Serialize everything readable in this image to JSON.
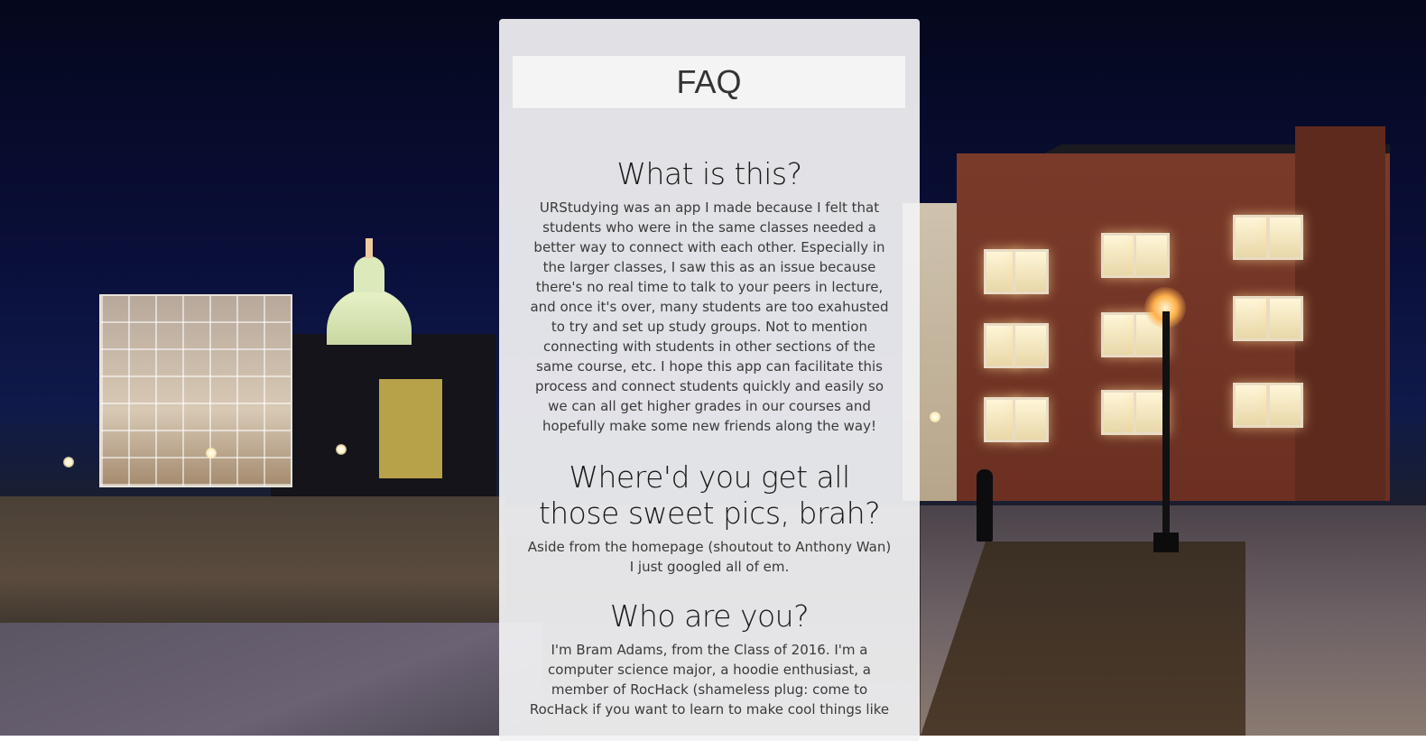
{
  "header": {
    "title": "FAQ"
  },
  "faq": [
    {
      "question": "What is this?",
      "answer": "URStudying was an app I made because I felt that students who were in the same classes needed a better way to connect with each other. Especially in the larger classes, I saw this as an issue because there's no real time to talk to your peers in lecture, and once it's over, many students are too exahusted to try and set up study groups. Not to mention connecting with students in other sections of the same course, etc. I hope this app can facilitate this process and connect students quickly and easily so we can all get higher grades in our courses and hopefully make some new friends along the way!"
    },
    {
      "question": "Where'd you get all those sweet pics, brah?",
      "answer": "Aside from the homepage (shoutout to Anthony Wan) I just googled all of em."
    },
    {
      "question": "Who are you?",
      "answer": "I'm Bram Adams, from the Class of 2016. I'm a computer science major, a hoodie enthusiast, a member of RocHack (shameless plug: come to RocHack if you want to learn to make cool things like"
    }
  ],
  "colors": {
    "panel_background": "#f2f2f4",
    "header_background": "#f4f4f4",
    "heading_text": "#1a1a1a",
    "body_text": "#3a3a3a"
  }
}
